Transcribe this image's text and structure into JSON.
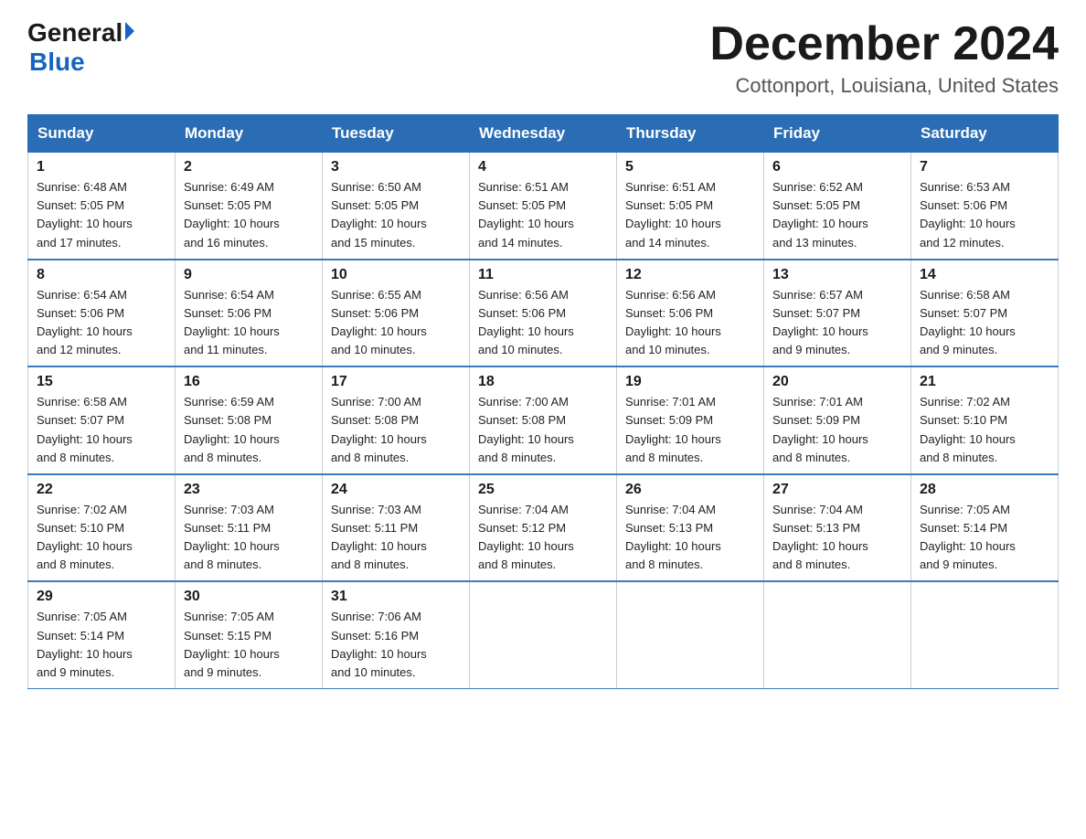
{
  "header": {
    "logo_general": "General",
    "logo_blue": "Blue",
    "month_title": "December 2024",
    "location": "Cottonport, Louisiana, United States"
  },
  "weekdays": [
    "Sunday",
    "Monday",
    "Tuesday",
    "Wednesday",
    "Thursday",
    "Friday",
    "Saturday"
  ],
  "weeks": [
    [
      {
        "day": "1",
        "sunrise": "6:48 AM",
        "sunset": "5:05 PM",
        "daylight": "10 hours and 17 minutes."
      },
      {
        "day": "2",
        "sunrise": "6:49 AM",
        "sunset": "5:05 PM",
        "daylight": "10 hours and 16 minutes."
      },
      {
        "day": "3",
        "sunrise": "6:50 AM",
        "sunset": "5:05 PM",
        "daylight": "10 hours and 15 minutes."
      },
      {
        "day": "4",
        "sunrise": "6:51 AM",
        "sunset": "5:05 PM",
        "daylight": "10 hours and 14 minutes."
      },
      {
        "day": "5",
        "sunrise": "6:51 AM",
        "sunset": "5:05 PM",
        "daylight": "10 hours and 14 minutes."
      },
      {
        "day": "6",
        "sunrise": "6:52 AM",
        "sunset": "5:05 PM",
        "daylight": "10 hours and 13 minutes."
      },
      {
        "day": "7",
        "sunrise": "6:53 AM",
        "sunset": "5:06 PM",
        "daylight": "10 hours and 12 minutes."
      }
    ],
    [
      {
        "day": "8",
        "sunrise": "6:54 AM",
        "sunset": "5:06 PM",
        "daylight": "10 hours and 12 minutes."
      },
      {
        "day": "9",
        "sunrise": "6:54 AM",
        "sunset": "5:06 PM",
        "daylight": "10 hours and 11 minutes."
      },
      {
        "day": "10",
        "sunrise": "6:55 AM",
        "sunset": "5:06 PM",
        "daylight": "10 hours and 10 minutes."
      },
      {
        "day": "11",
        "sunrise": "6:56 AM",
        "sunset": "5:06 PM",
        "daylight": "10 hours and 10 minutes."
      },
      {
        "day": "12",
        "sunrise": "6:56 AM",
        "sunset": "5:06 PM",
        "daylight": "10 hours and 10 minutes."
      },
      {
        "day": "13",
        "sunrise": "6:57 AM",
        "sunset": "5:07 PM",
        "daylight": "10 hours and 9 minutes."
      },
      {
        "day": "14",
        "sunrise": "6:58 AM",
        "sunset": "5:07 PM",
        "daylight": "10 hours and 9 minutes."
      }
    ],
    [
      {
        "day": "15",
        "sunrise": "6:58 AM",
        "sunset": "5:07 PM",
        "daylight": "10 hours and 8 minutes."
      },
      {
        "day": "16",
        "sunrise": "6:59 AM",
        "sunset": "5:08 PM",
        "daylight": "10 hours and 8 minutes."
      },
      {
        "day": "17",
        "sunrise": "7:00 AM",
        "sunset": "5:08 PM",
        "daylight": "10 hours and 8 minutes."
      },
      {
        "day": "18",
        "sunrise": "7:00 AM",
        "sunset": "5:08 PM",
        "daylight": "10 hours and 8 minutes."
      },
      {
        "day": "19",
        "sunrise": "7:01 AM",
        "sunset": "5:09 PM",
        "daylight": "10 hours and 8 minutes."
      },
      {
        "day": "20",
        "sunrise": "7:01 AM",
        "sunset": "5:09 PM",
        "daylight": "10 hours and 8 minutes."
      },
      {
        "day": "21",
        "sunrise": "7:02 AM",
        "sunset": "5:10 PM",
        "daylight": "10 hours and 8 minutes."
      }
    ],
    [
      {
        "day": "22",
        "sunrise": "7:02 AM",
        "sunset": "5:10 PM",
        "daylight": "10 hours and 8 minutes."
      },
      {
        "day": "23",
        "sunrise": "7:03 AM",
        "sunset": "5:11 PM",
        "daylight": "10 hours and 8 minutes."
      },
      {
        "day": "24",
        "sunrise": "7:03 AM",
        "sunset": "5:11 PM",
        "daylight": "10 hours and 8 minutes."
      },
      {
        "day": "25",
        "sunrise": "7:04 AM",
        "sunset": "5:12 PM",
        "daylight": "10 hours and 8 minutes."
      },
      {
        "day": "26",
        "sunrise": "7:04 AM",
        "sunset": "5:13 PM",
        "daylight": "10 hours and 8 minutes."
      },
      {
        "day": "27",
        "sunrise": "7:04 AM",
        "sunset": "5:13 PM",
        "daylight": "10 hours and 8 minutes."
      },
      {
        "day": "28",
        "sunrise": "7:05 AM",
        "sunset": "5:14 PM",
        "daylight": "10 hours and 9 minutes."
      }
    ],
    [
      {
        "day": "29",
        "sunrise": "7:05 AM",
        "sunset": "5:14 PM",
        "daylight": "10 hours and 9 minutes."
      },
      {
        "day": "30",
        "sunrise": "7:05 AM",
        "sunset": "5:15 PM",
        "daylight": "10 hours and 9 minutes."
      },
      {
        "day": "31",
        "sunrise": "7:06 AM",
        "sunset": "5:16 PM",
        "daylight": "10 hours and 10 minutes."
      },
      null,
      null,
      null,
      null
    ]
  ],
  "labels": {
    "sunrise": "Sunrise:",
    "sunset": "Sunset:",
    "daylight": "Daylight:"
  }
}
